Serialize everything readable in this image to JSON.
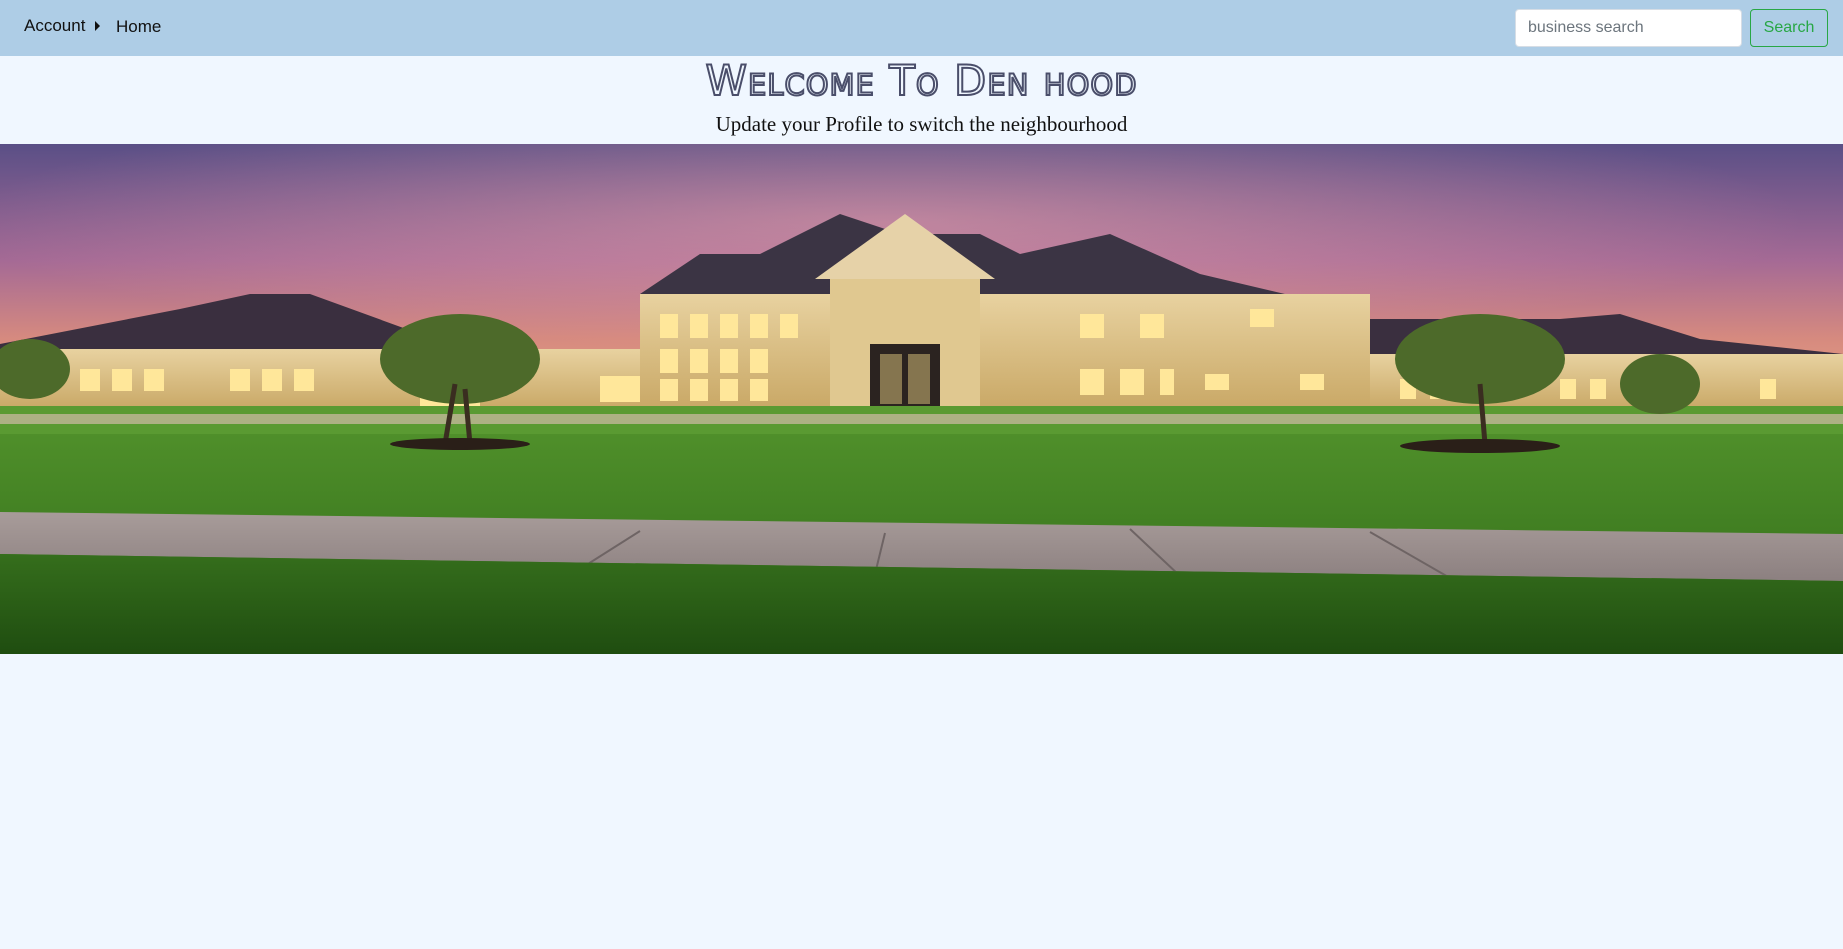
{
  "navbar": {
    "account_label": "Account",
    "home_label": "Home",
    "search": {
      "placeholder": "business search",
      "value": ""
    },
    "search_button_label": "Search"
  },
  "header": {
    "title": "Welcome To Den hood",
    "subtitle": "Update your Profile to switch the neighbourhood"
  },
  "colors": {
    "navbar_bg": "#aecde6",
    "page_bg": "#f0f7ff",
    "search_accent": "#28a745"
  },
  "icons": {
    "account_caret": "caret-right-icon"
  }
}
